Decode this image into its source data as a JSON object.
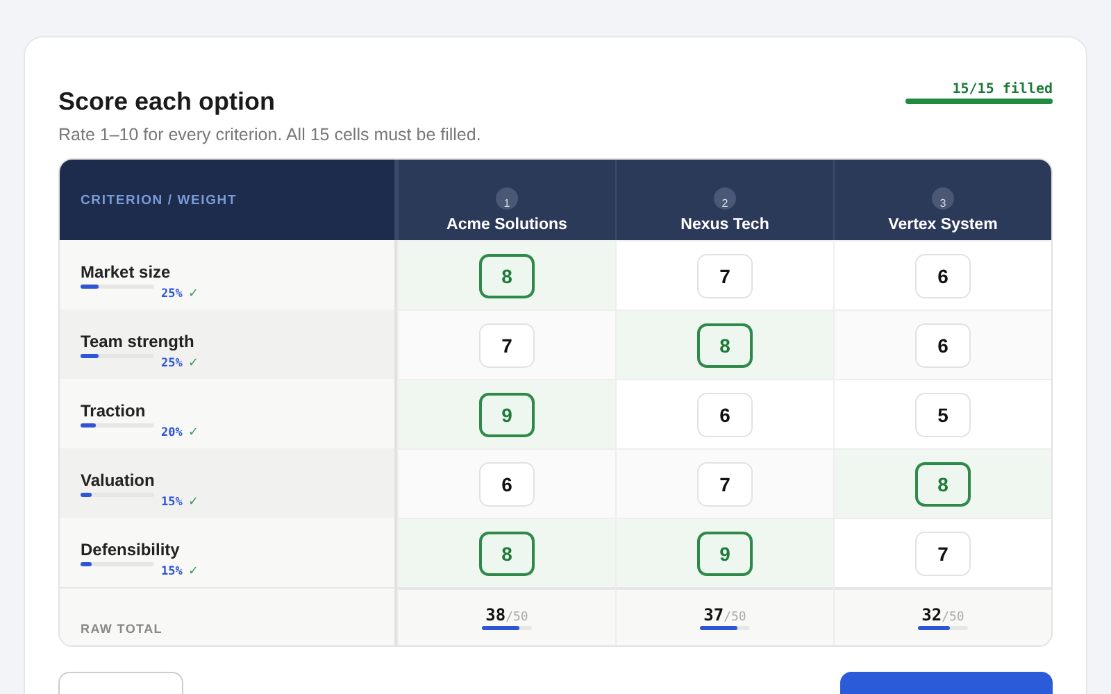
{
  "title": "Score each option",
  "subtitle": "Rate 1–10 for every criterion. All 15 cells must be filled.",
  "progress": {
    "label": "15/15 filled",
    "level": 1
  },
  "table": {
    "corner": "CRITERION / WEIGHT",
    "options": [
      {
        "index": "1",
        "name": "Acme Solutions"
      },
      {
        "index": "2",
        "name": "Nexus Tech"
      },
      {
        "index": "3",
        "name": "Vertex System"
      }
    ],
    "rows": [
      {
        "name": "Market size",
        "weight": "25%",
        "level": 0.25,
        "check": "✓",
        "scores": [
          {
            "value": "8",
            "selected": true
          },
          {
            "value": "7",
            "selected": false
          },
          {
            "value": "6",
            "selected": false
          }
        ]
      },
      {
        "name": "Team strength",
        "weight": "25%",
        "level": 0.25,
        "check": "✓",
        "scores": [
          {
            "value": "7",
            "selected": false
          },
          {
            "value": "8",
            "selected": true
          },
          {
            "value": "6",
            "selected": false
          }
        ]
      },
      {
        "name": "Traction",
        "weight": "20%",
        "level": 0.2,
        "check": "✓",
        "scores": [
          {
            "value": "9",
            "selected": true
          },
          {
            "value": "6",
            "selected": false
          },
          {
            "value": "5",
            "selected": false
          }
        ]
      },
      {
        "name": "Valuation",
        "weight": "15%",
        "level": 0.15,
        "check": "✓",
        "scores": [
          {
            "value": "6",
            "selected": false
          },
          {
            "value": "7",
            "selected": false
          },
          {
            "value": "8",
            "selected": true
          }
        ]
      },
      {
        "name": "Defensibility",
        "weight": "15%",
        "level": 0.15,
        "check": "✓",
        "scores": [
          {
            "value": "8",
            "selected": true
          },
          {
            "value": "9",
            "selected": true
          },
          {
            "value": "7",
            "selected": false
          }
        ]
      }
    ],
    "total": {
      "label": "RAW TOTAL",
      "values": [
        {
          "score": "38",
          "max": "/50",
          "level": 0.76
        },
        {
          "score": "37",
          "max": "/50",
          "level": 0.74
        },
        {
          "score": "32",
          "max": "/50",
          "level": 0.64
        }
      ]
    }
  }
}
